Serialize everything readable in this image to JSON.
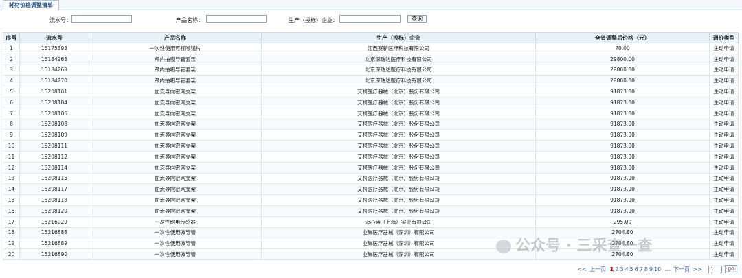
{
  "tab": {
    "title": "耗材价格调整清单"
  },
  "search": {
    "serial_label": "流水号：",
    "product_label": "产品名称：",
    "maker_label": "生产（投标）企业：",
    "query_button": "查询"
  },
  "table": {
    "headers": [
      "序号",
      "流水号",
      "产品名称",
      "生产（投标）企业",
      "全省调整后价格（元）",
      "调价类型"
    ],
    "rows": [
      [
        "1",
        "15175393",
        "一次性使用可视喉镜片",
        "江西赛新医疗科技有限公司",
        "70.00",
        "主动申请"
      ],
      [
        "2",
        "15184268",
        "颅内抽吸导管套装",
        "北京深瑞达医疗科技有限公司",
        "29800.00",
        "主动申请"
      ],
      [
        "3",
        "15184269",
        "颅内抽吸导管套装",
        "北京深瑞达医疗科技有限公司",
        "29800.00",
        "主动申请"
      ],
      [
        "4",
        "15184270",
        "颅内抽吸导管套装",
        "北京深瑞达医疗科技有限公司",
        "29800.00",
        "主动申请"
      ],
      [
        "5",
        "15208101",
        "血流导向密网支架",
        "艾柯医疗器械（北京）股份有限公司",
        "91873.00",
        "主动申请"
      ],
      [
        "6",
        "15208104",
        "血流导向密网支架",
        "艾柯医疗器械（北京）股份有限公司",
        "91873.00",
        "主动申请"
      ],
      [
        "7",
        "15208106",
        "血流导向密网支架",
        "艾柯医疗器械（北京）股份有限公司",
        "91873.00",
        "主动申请"
      ],
      [
        "8",
        "15208108",
        "血流导向密网支架",
        "艾柯医疗器械（北京）股份有限公司",
        "91873.00",
        "主动申请"
      ],
      [
        "9",
        "15208109",
        "血流导向密网支架",
        "艾柯医疗器械（北京）股份有限公司",
        "91873.00",
        "主动申请"
      ],
      [
        "10",
        "15208111",
        "血流导向密网支架",
        "艾柯医疗器械（北京）股份有限公司",
        "91873.00",
        "主动申请"
      ],
      [
        "11",
        "15208112",
        "血流导向密网支架",
        "艾柯医疗器械（北京）股份有限公司",
        "91873.00",
        "主动申请"
      ],
      [
        "12",
        "15208114",
        "血流导向密网支架",
        "艾柯医疗器械（北京）股份有限公司",
        "91873.00",
        "主动申请"
      ],
      [
        "13",
        "15208115",
        "血流导向密网支架",
        "艾柯医疗器械（北京）股份有限公司",
        "91873.00",
        "主动申请"
      ],
      [
        "14",
        "15208117",
        "血流导向密网支架",
        "艾柯医疗器械（北京）股份有限公司",
        "91873.00",
        "主动申请"
      ],
      [
        "15",
        "15208118",
        "血流导向密网支架",
        "艾柯医疗器械（北京）股份有限公司",
        "91873.00",
        "主动申请"
      ],
      [
        "16",
        "15208120",
        "血流导向密网支架",
        "艾柯医疗器械（北京）股份有限公司",
        "91873.00",
        "主动申请"
      ],
      [
        "17",
        "15216029",
        "一次性脑电传感器",
        "迈心诺（上海）实业有限公司",
        "295.00",
        "主动申请"
      ],
      [
        "18",
        "15216888",
        "一次性使用微导管",
        "业聚医疗器械（深圳）有限公司",
        "2704.80",
        "主动申请"
      ],
      [
        "19",
        "15216889",
        "一次性使用微导管",
        "业聚医疗器械（深圳）有限公司",
        "2704.80",
        "主动申请"
      ],
      [
        "20",
        "15216890",
        "一次性使用微导管",
        "业聚医疗器械（深圳）有限公司",
        "2704.80",
        "主动申请"
      ]
    ]
  },
  "pager": {
    "first": "<<",
    "prev": "上一页",
    "pages": [
      "1",
      "2",
      "3",
      "4",
      "5",
      "6",
      "7",
      "8",
      "9",
      "10"
    ],
    "current": "1",
    "ellipsis": "...",
    "next": "下一页",
    "last": ">>",
    "page_input": "1",
    "go": "go"
  },
  "watermark": {
    "text": "公众号 · 三采查一查"
  }
}
